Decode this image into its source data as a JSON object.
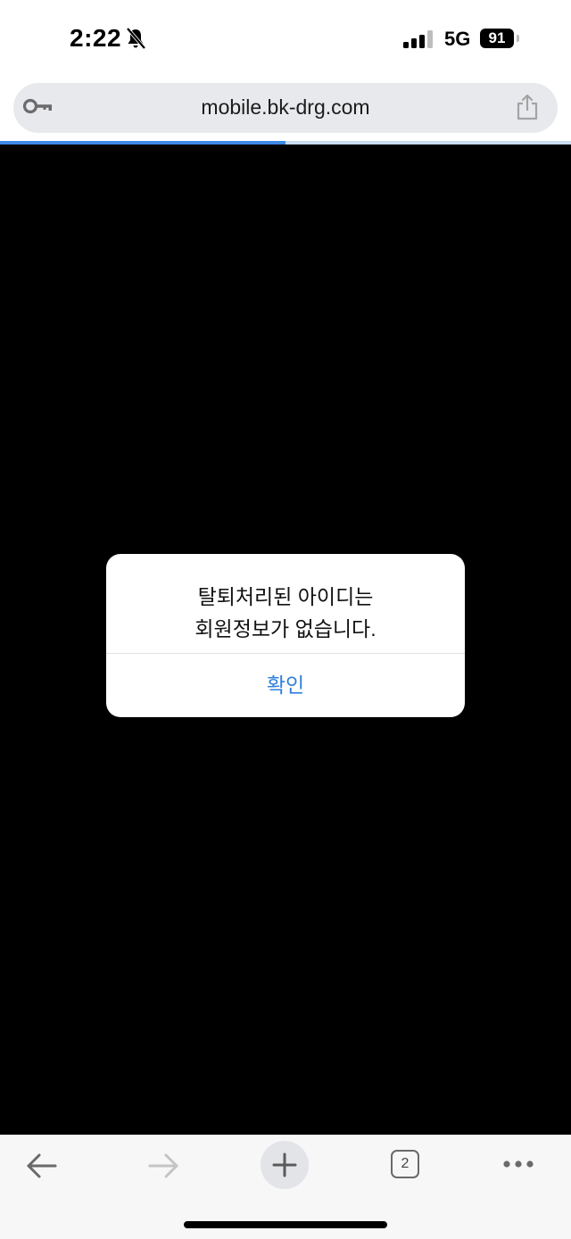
{
  "status_bar": {
    "time": "2:22",
    "network": "5G",
    "battery": "91",
    "icons": [
      "bell-slash-icon",
      "cellular-signal-icon",
      "battery-icon"
    ]
  },
  "address_bar": {
    "url": "mobile.bk-drg.com",
    "icons": [
      "key-icon",
      "share-icon"
    ],
    "load_progress": 0.5
  },
  "alert": {
    "message_line1": "탈퇴처리된 아이디는",
    "message_line2": "회원정보가 없습니다.",
    "confirm_label": "확인"
  },
  "toolbar": {
    "tab_count": "2",
    "icons": [
      "back-arrow-icon",
      "forward-arrow-icon",
      "plus-icon",
      "tabs-icon",
      "more-icon"
    ]
  },
  "colors": {
    "page_background": "#000000",
    "accent": "#2f7fdc",
    "progress": "#3d8ae6",
    "address_bar": "#e8e9ec"
  }
}
